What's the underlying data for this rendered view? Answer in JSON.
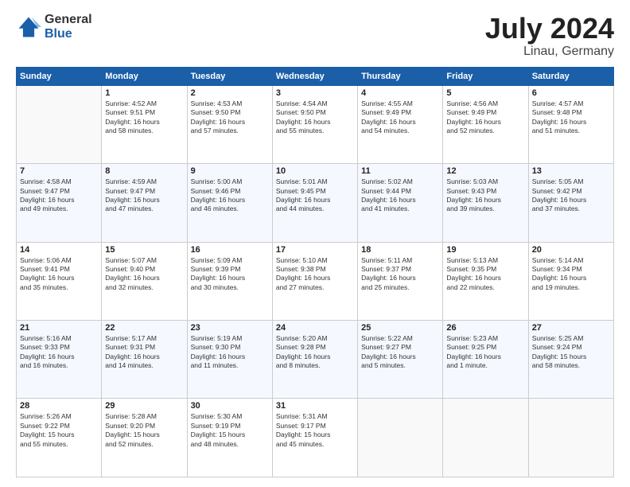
{
  "logo": {
    "general": "General",
    "blue": "Blue"
  },
  "header": {
    "month": "July 2024",
    "location": "Linau, Germany"
  },
  "days_of_week": [
    "Sunday",
    "Monday",
    "Tuesday",
    "Wednesday",
    "Thursday",
    "Friday",
    "Saturday"
  ],
  "weeks": [
    [
      {
        "day": "",
        "info": ""
      },
      {
        "day": "1",
        "info": "Sunrise: 4:52 AM\nSunset: 9:51 PM\nDaylight: 16 hours\nand 58 minutes."
      },
      {
        "day": "2",
        "info": "Sunrise: 4:53 AM\nSunset: 9:50 PM\nDaylight: 16 hours\nand 57 minutes."
      },
      {
        "day": "3",
        "info": "Sunrise: 4:54 AM\nSunset: 9:50 PM\nDaylight: 16 hours\nand 55 minutes."
      },
      {
        "day": "4",
        "info": "Sunrise: 4:55 AM\nSunset: 9:49 PM\nDaylight: 16 hours\nand 54 minutes."
      },
      {
        "day": "5",
        "info": "Sunrise: 4:56 AM\nSunset: 9:49 PM\nDaylight: 16 hours\nand 52 minutes."
      },
      {
        "day": "6",
        "info": "Sunrise: 4:57 AM\nSunset: 9:48 PM\nDaylight: 16 hours\nand 51 minutes."
      }
    ],
    [
      {
        "day": "7",
        "info": "Sunrise: 4:58 AM\nSunset: 9:47 PM\nDaylight: 16 hours\nand 49 minutes."
      },
      {
        "day": "8",
        "info": "Sunrise: 4:59 AM\nSunset: 9:47 PM\nDaylight: 16 hours\nand 47 minutes."
      },
      {
        "day": "9",
        "info": "Sunrise: 5:00 AM\nSunset: 9:46 PM\nDaylight: 16 hours\nand 46 minutes."
      },
      {
        "day": "10",
        "info": "Sunrise: 5:01 AM\nSunset: 9:45 PM\nDaylight: 16 hours\nand 44 minutes."
      },
      {
        "day": "11",
        "info": "Sunrise: 5:02 AM\nSunset: 9:44 PM\nDaylight: 16 hours\nand 41 minutes."
      },
      {
        "day": "12",
        "info": "Sunrise: 5:03 AM\nSunset: 9:43 PM\nDaylight: 16 hours\nand 39 minutes."
      },
      {
        "day": "13",
        "info": "Sunrise: 5:05 AM\nSunset: 9:42 PM\nDaylight: 16 hours\nand 37 minutes."
      }
    ],
    [
      {
        "day": "14",
        "info": "Sunrise: 5:06 AM\nSunset: 9:41 PM\nDaylight: 16 hours\nand 35 minutes."
      },
      {
        "day": "15",
        "info": "Sunrise: 5:07 AM\nSunset: 9:40 PM\nDaylight: 16 hours\nand 32 minutes."
      },
      {
        "day": "16",
        "info": "Sunrise: 5:09 AM\nSunset: 9:39 PM\nDaylight: 16 hours\nand 30 minutes."
      },
      {
        "day": "17",
        "info": "Sunrise: 5:10 AM\nSunset: 9:38 PM\nDaylight: 16 hours\nand 27 minutes."
      },
      {
        "day": "18",
        "info": "Sunrise: 5:11 AM\nSunset: 9:37 PM\nDaylight: 16 hours\nand 25 minutes."
      },
      {
        "day": "19",
        "info": "Sunrise: 5:13 AM\nSunset: 9:35 PM\nDaylight: 16 hours\nand 22 minutes."
      },
      {
        "day": "20",
        "info": "Sunrise: 5:14 AM\nSunset: 9:34 PM\nDaylight: 16 hours\nand 19 minutes."
      }
    ],
    [
      {
        "day": "21",
        "info": "Sunrise: 5:16 AM\nSunset: 9:33 PM\nDaylight: 16 hours\nand 16 minutes."
      },
      {
        "day": "22",
        "info": "Sunrise: 5:17 AM\nSunset: 9:31 PM\nDaylight: 16 hours\nand 14 minutes."
      },
      {
        "day": "23",
        "info": "Sunrise: 5:19 AM\nSunset: 9:30 PM\nDaylight: 16 hours\nand 11 minutes."
      },
      {
        "day": "24",
        "info": "Sunrise: 5:20 AM\nSunset: 9:28 PM\nDaylight: 16 hours\nand 8 minutes."
      },
      {
        "day": "25",
        "info": "Sunrise: 5:22 AM\nSunset: 9:27 PM\nDaylight: 16 hours\nand 5 minutes."
      },
      {
        "day": "26",
        "info": "Sunrise: 5:23 AM\nSunset: 9:25 PM\nDaylight: 16 hours\nand 1 minute."
      },
      {
        "day": "27",
        "info": "Sunrise: 5:25 AM\nSunset: 9:24 PM\nDaylight: 15 hours\nand 58 minutes."
      }
    ],
    [
      {
        "day": "28",
        "info": "Sunrise: 5:26 AM\nSunset: 9:22 PM\nDaylight: 15 hours\nand 55 minutes."
      },
      {
        "day": "29",
        "info": "Sunrise: 5:28 AM\nSunset: 9:20 PM\nDaylight: 15 hours\nand 52 minutes."
      },
      {
        "day": "30",
        "info": "Sunrise: 5:30 AM\nSunset: 9:19 PM\nDaylight: 15 hours\nand 48 minutes."
      },
      {
        "day": "31",
        "info": "Sunrise: 5:31 AM\nSunset: 9:17 PM\nDaylight: 15 hours\nand 45 minutes."
      },
      {
        "day": "",
        "info": ""
      },
      {
        "day": "",
        "info": ""
      },
      {
        "day": "",
        "info": ""
      }
    ]
  ]
}
